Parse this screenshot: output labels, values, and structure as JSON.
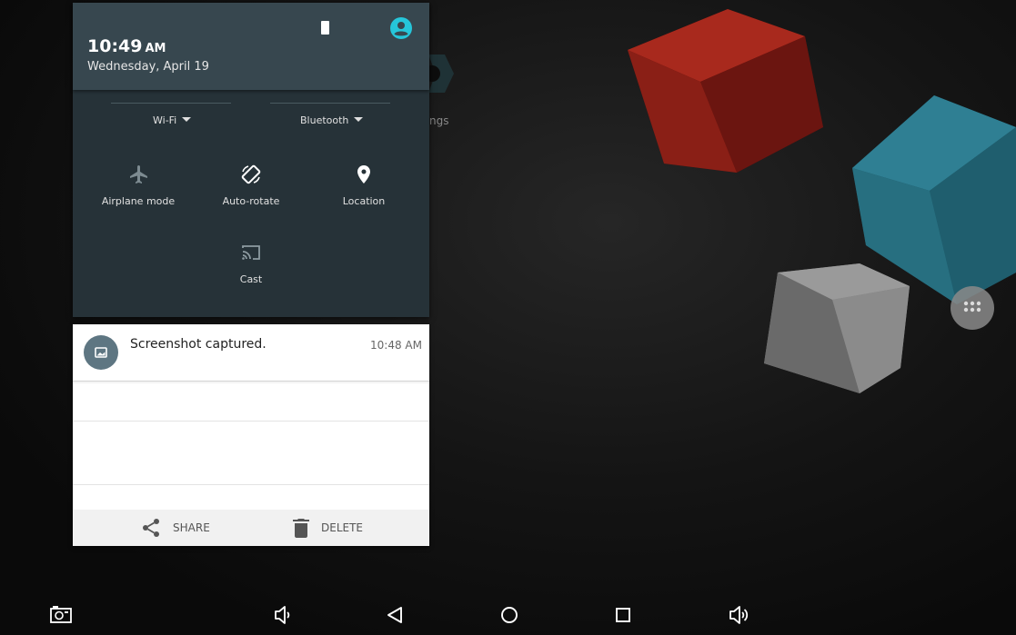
{
  "quick_settings": {
    "time": "10:49",
    "time_ampm": "AM",
    "date": "Wednesday, April 19",
    "dropdowns": [
      {
        "label": "Wi-Fi"
      },
      {
        "label": "Bluetooth"
      }
    ],
    "tiles": [
      {
        "label": "Airplane mode",
        "icon": "airplane-icon",
        "state": "off"
      },
      {
        "label": "Auto-rotate",
        "icon": "auto-rotate-icon",
        "state": "on"
      },
      {
        "label": "Location",
        "icon": "location-icon",
        "state": "on"
      },
      {
        "label": "Cast",
        "icon": "cast-icon",
        "state": "off"
      }
    ]
  },
  "notification": {
    "title": "Screenshot captured.",
    "time": "10:48 AM",
    "actions": [
      {
        "label": "SHARE",
        "icon": "share-icon"
      },
      {
        "label": "DELETE",
        "icon": "trash-icon"
      }
    ]
  },
  "launcher": {
    "settings_label_fragment": "ngs"
  },
  "nav_bar": {
    "buttons": [
      "screenshot-icon",
      "volume-down-icon",
      "back-icon",
      "home-icon",
      "recents-icon",
      "volume-up-icon"
    ]
  },
  "colors": {
    "accent": "#26c6da",
    "panel": "#263238",
    "panel_header": "#37474f"
  }
}
